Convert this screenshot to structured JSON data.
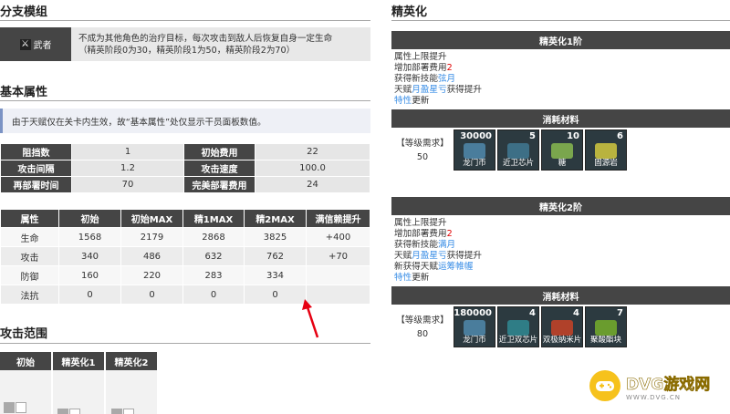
{
  "branch": {
    "heading": "分支模组",
    "name": "武者",
    "desc_line1": "不成为其他角色的治疗目标，每次攻击到敌人后恢复自身一定生命",
    "desc_line2": "（精英阶段0为30，精英阶段1为50，精英阶段2为70）"
  },
  "basic": {
    "heading": "基本属性",
    "note": "由于天赋仅在关卡内生效，故“基本属性”处仅显示干员面板数值。",
    "stats": [
      [
        "阻挡数",
        "1",
        "初始费用",
        "22"
      ],
      [
        "攻击间隔",
        "1.2",
        "攻击速度",
        "100.0"
      ],
      [
        "再部署时间",
        "70",
        "完美部署费用",
        "24"
      ]
    ],
    "attr_headers": [
      "属性",
      "初始",
      "初始MAX",
      "精1MAX",
      "精2MAX",
      "满信赖提升"
    ],
    "attr_rows": [
      [
        "生命",
        "1568",
        "2179",
        "2868",
        "3825",
        "+400"
      ],
      [
        "攻击",
        "340",
        "486",
        "632",
        "762",
        "+70"
      ],
      [
        "防御",
        "160",
        "220",
        "283",
        "334",
        ""
      ],
      [
        "法抗",
        "0",
        "0",
        "0",
        "0",
        ""
      ]
    ]
  },
  "range": {
    "heading": "攻击范围",
    "cols": [
      "初始",
      "精英化1",
      "精英化2"
    ]
  },
  "elite": {
    "heading": "精英化",
    "e1": {
      "title": "精英化1阶",
      "l1": "属性上限提升",
      "l2a": "增加部署费用",
      "l2b": "2",
      "l3a": "获得新技能",
      "l3b": "弦月",
      "l4a": "天赋",
      "l4b": "月盈星亏",
      "l4c": "获得提升",
      "l5a": "特性",
      "l5b": "更新",
      "mat_title": "消耗材料",
      "req_label": "【等级需求】",
      "req_val": "50",
      "mats": [
        {
          "count": "30000",
          "name": "龙门币",
          "color": "#4a7d9c"
        },
        {
          "count": "5",
          "name": "近卫芯片",
          "color": "#3d6f86"
        },
        {
          "count": "10",
          "name": "糖",
          "color": "#7aa64d"
        },
        {
          "count": "6",
          "name": "固源岩",
          "color": "#b9b33f"
        }
      ]
    },
    "e2": {
      "title": "精英化2阶",
      "l1": "属性上限提升",
      "l2a": "增加部署费用",
      "l2b": "2",
      "l3a": "获得新技能",
      "l3b": "满月",
      "l4a": "天赋",
      "l4b": "月盈星亏",
      "l4c": "获得提升",
      "l5a": "新获得天赋",
      "l5b": "运筹帷幄",
      "l6a": "特性",
      "l6b": "更新",
      "mat_title": "消耗材料",
      "req_label": "【等级需求】",
      "req_val": "80",
      "mats": [
        {
          "count": "180000",
          "name": "龙门币",
          "color": "#4a7d9c"
        },
        {
          "count": "4",
          "name": "近卫双芯片",
          "color": "#2f7d86"
        },
        {
          "count": "4",
          "name": "双极纳米片",
          "color": "#b0412a"
        },
        {
          "count": "7",
          "name": "聚酸酯块",
          "color": "#6a9c2e"
        }
      ]
    }
  },
  "watermark": {
    "title": "DVG游戏网",
    "sub": "WWW.DVG.CN"
  }
}
